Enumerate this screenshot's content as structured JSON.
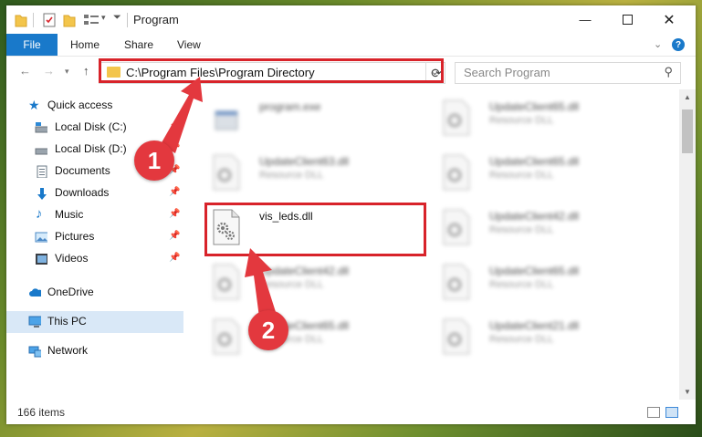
{
  "window": {
    "title": "Program"
  },
  "ribbon": {
    "tabs": [
      "File",
      "Home",
      "Share",
      "View"
    ],
    "help": "?"
  },
  "address": {
    "path": "C:\\Program Files\\Program Directory"
  },
  "search": {
    "placeholder": "Search Program"
  },
  "nav": [
    {
      "label": "Quick access",
      "icon": "star-icon"
    },
    {
      "label": "Local Disk (C:)",
      "icon": "drive-icon",
      "pinned": true
    },
    {
      "label": "Local Disk (D:)",
      "icon": "drive-icon",
      "pinned": true
    },
    {
      "label": "Documents",
      "icon": "documents-icon",
      "pinned": true
    },
    {
      "label": "Downloads",
      "icon": "download-icon",
      "pinned": true
    },
    {
      "label": "Music",
      "icon": "music-icon",
      "pinned": true
    },
    {
      "label": "Pictures",
      "icon": "pictures-icon",
      "pinned": true
    },
    {
      "label": "Videos",
      "icon": "videos-icon",
      "pinned": true
    },
    {
      "label": "OneDrive",
      "icon": "cloud-icon"
    },
    {
      "label": "This PC",
      "icon": "computer-icon",
      "selected": true
    },
    {
      "label": "Network",
      "icon": "network-icon"
    }
  ],
  "files": [
    {
      "name": "program.exe",
      "type": ""
    },
    {
      "name": "UpdateClient65.dll",
      "type": "Resource DLL"
    },
    {
      "name": "UpdateClient63.dll",
      "type": "Resource DLL"
    },
    {
      "name": "UpdateClient65.dll",
      "type": "Resource DLL"
    },
    {
      "name": "vis_leds.dll",
      "type": ""
    },
    {
      "name": "UpdateClient42.dll",
      "type": "Resource DLL"
    },
    {
      "name": "UpdateClient42.dll",
      "type": "Resource DLL"
    },
    {
      "name": "UpdateClient65.dll",
      "type": "Resource DLL"
    },
    {
      "name": "UpdateClient65.dll",
      "type": "Resource DLL"
    },
    {
      "name": "UpdateClient21.dll",
      "type": "Resource DLL"
    }
  ],
  "status": {
    "item_count": "166 items"
  },
  "callouts": [
    "1",
    "2"
  ],
  "colors": {
    "accent": "#1979ca",
    "highlight": "#d8232a",
    "callout": "#e3383e"
  }
}
